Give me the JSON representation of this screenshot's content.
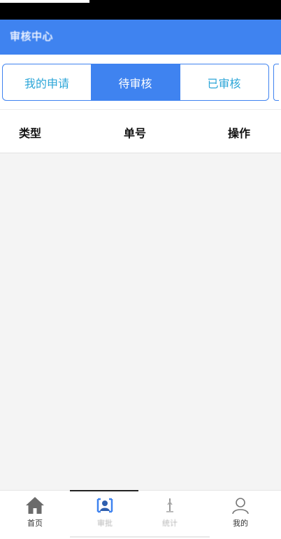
{
  "header": {
    "title": "审核中心"
  },
  "tabs": [
    {
      "label": "我的申请"
    },
    {
      "label": "待审核"
    },
    {
      "label": "已审核"
    }
  ],
  "table": {
    "columns": [
      "类型",
      "单号",
      "操作"
    ],
    "rows": []
  },
  "bottom_nav": {
    "items": [
      {
        "label": "首页",
        "icon": "home-icon"
      },
      {
        "label": "审批",
        "icon": "approval-icon"
      },
      {
        "label": "统计",
        "icon": "stats-icon"
      },
      {
        "label": "我的",
        "icon": "user-icon"
      }
    ]
  },
  "colors": {
    "primary": "#3f83f0",
    "tab_text": "#2ca6d8",
    "background": "#f4f4f4"
  }
}
